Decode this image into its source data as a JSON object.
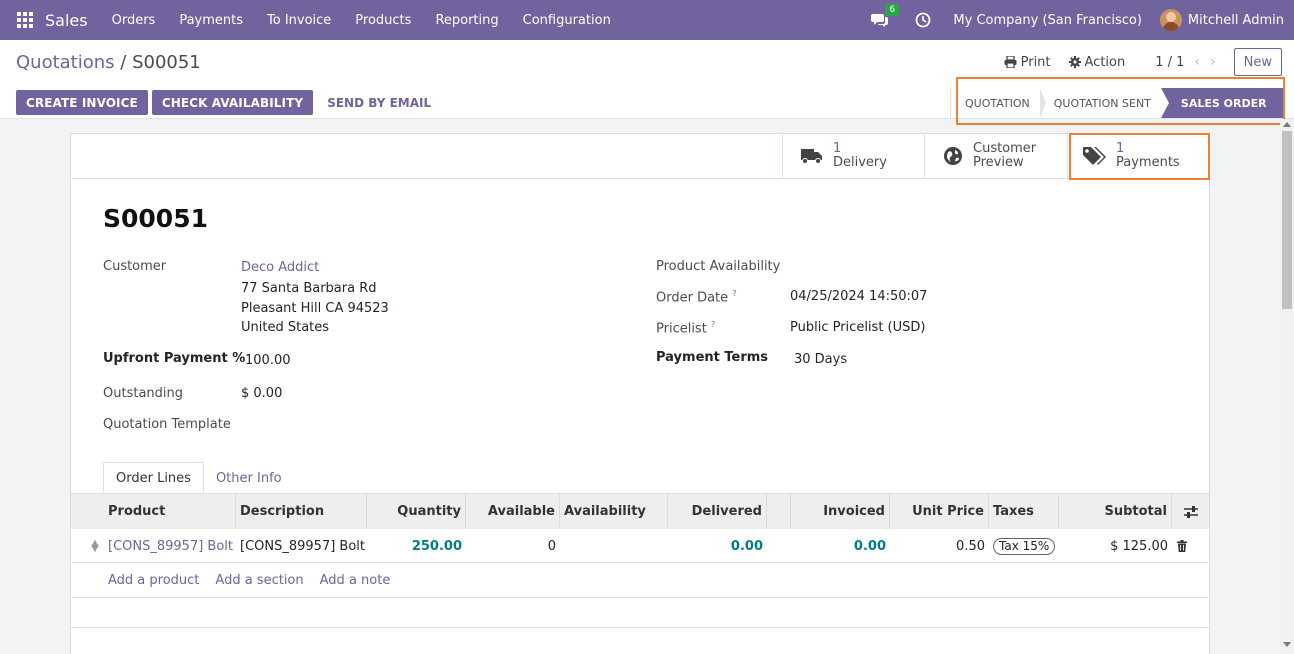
{
  "navbar": {
    "brand": "Sales",
    "menu": [
      "Orders",
      "Payments",
      "To Invoice",
      "Products",
      "Reporting",
      "Configuration"
    ],
    "chat_badge": "6",
    "company": "My Company (San Francisco)",
    "user": "Mitchell Admin"
  },
  "control": {
    "breadcrumb_parent": "Quotations",
    "breadcrumb_sep": " / ",
    "breadcrumb_current": "S00051",
    "print_label": "Print",
    "action_label": "Action",
    "pager": "1 / 1",
    "new_label": "New",
    "buttons": [
      "CREATE INVOICE",
      "CHECK AVAILABILITY"
    ],
    "send_email": "SEND BY EMAIL",
    "stages": [
      "QUOTATION",
      "QUOTATION SENT",
      "SALES ORDER"
    ]
  },
  "smart_buttons": {
    "delivery_count": "1",
    "delivery_label": "Delivery",
    "preview_line1": "Customer",
    "preview_line2": "Preview",
    "payments_count": "1",
    "payments_label": "Payments"
  },
  "form": {
    "title": "S00051",
    "customer_label": "Customer",
    "customer_name": "Deco Addict",
    "address1": "77 Santa Barbara Rd",
    "address2": "Pleasant Hill CA 94523",
    "address3": "United States",
    "upfront_label": "Upfront Payment %",
    "upfront_value": "100.00",
    "outstanding_label": "Outstanding",
    "outstanding_value": "$ 0.00",
    "template_label": "Quotation Template",
    "availability_label": "Product Availability",
    "order_date_label": "Order Date",
    "order_date_value": "04/25/2024 14:50:07",
    "pricelist_label": "Pricelist",
    "pricelist_value": "Public Pricelist (USD)",
    "terms_label": "Payment Terms",
    "terms_value": "30 Days",
    "help_mark": "?"
  },
  "tabs": [
    "Order Lines",
    "Other Info"
  ],
  "table": {
    "headers": [
      "Product",
      "Description",
      "Quantity",
      "Available",
      "Availability",
      "Delivered",
      "Invoiced",
      "Unit Price",
      "Taxes",
      "Subtotal"
    ],
    "row": {
      "product": "[CONS_89957] Bolt",
      "description": "[CONS_89957] Bolt",
      "quantity": "250.00",
      "available": "0",
      "delivered": "0.00",
      "invoiced": "0.00",
      "unit_price": "0.50",
      "tax": "Tax 15%",
      "subtotal": "$ 125.00"
    },
    "add_links": [
      "Add a product",
      "Add a section",
      "Add a note"
    ]
  },
  "colors": {
    "brand": "#71639e",
    "highlight": "#f07f31",
    "numeric": "#017e84"
  }
}
